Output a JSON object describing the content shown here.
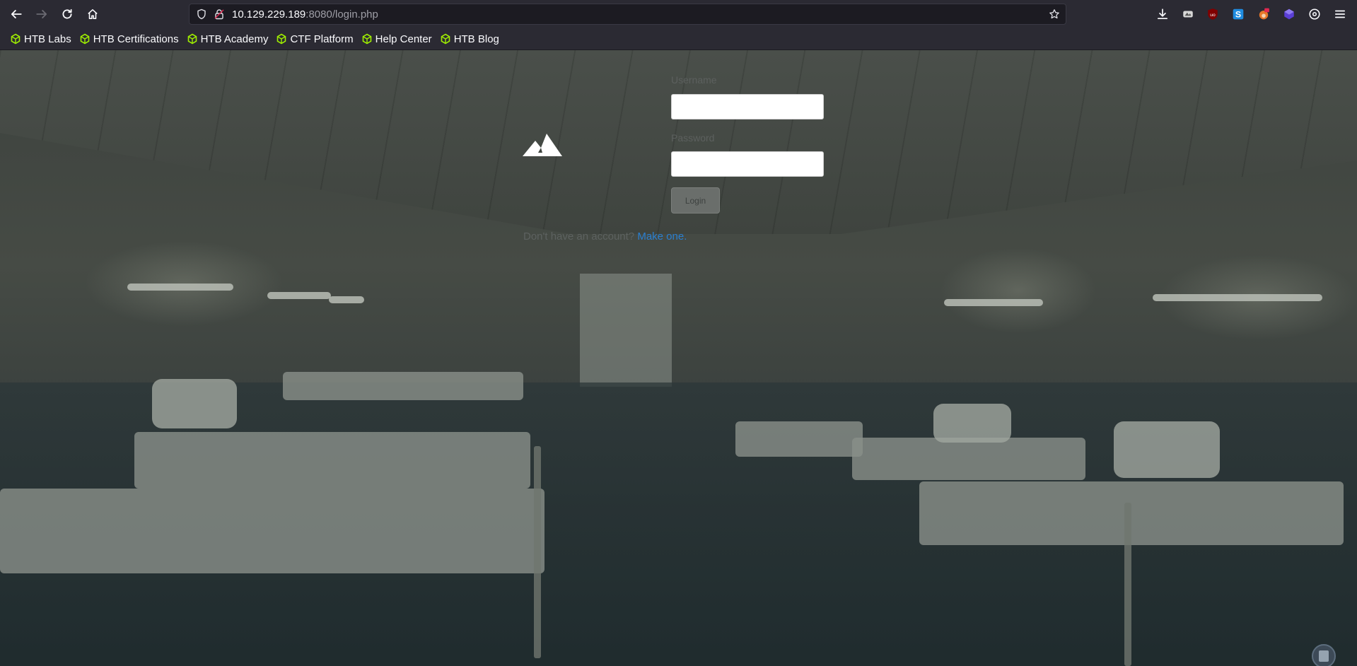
{
  "browser": {
    "url": {
      "host": "10.129.229.189",
      "rest": ":8080/login.php"
    },
    "bookmarks": [
      {
        "label": "HTB Labs",
        "icon": "htb-cube-icon"
      },
      {
        "label": "HTB Certifications",
        "icon": "htb-cube-icon"
      },
      {
        "label": "HTB Academy",
        "icon": "htb-cube-icon"
      },
      {
        "label": "CTF Platform",
        "icon": "htb-cube-icon"
      },
      {
        "label": "Help Center",
        "icon": "htb-cube-icon"
      },
      {
        "label": "HTB Blog",
        "icon": "htb-cube-icon"
      }
    ],
    "accent": "#9fef00"
  },
  "login": {
    "username_label": "Username",
    "password_label": "Password",
    "login_button": "Login",
    "signup_prompt": "Don't have an account?",
    "signup_link": "Make one."
  }
}
